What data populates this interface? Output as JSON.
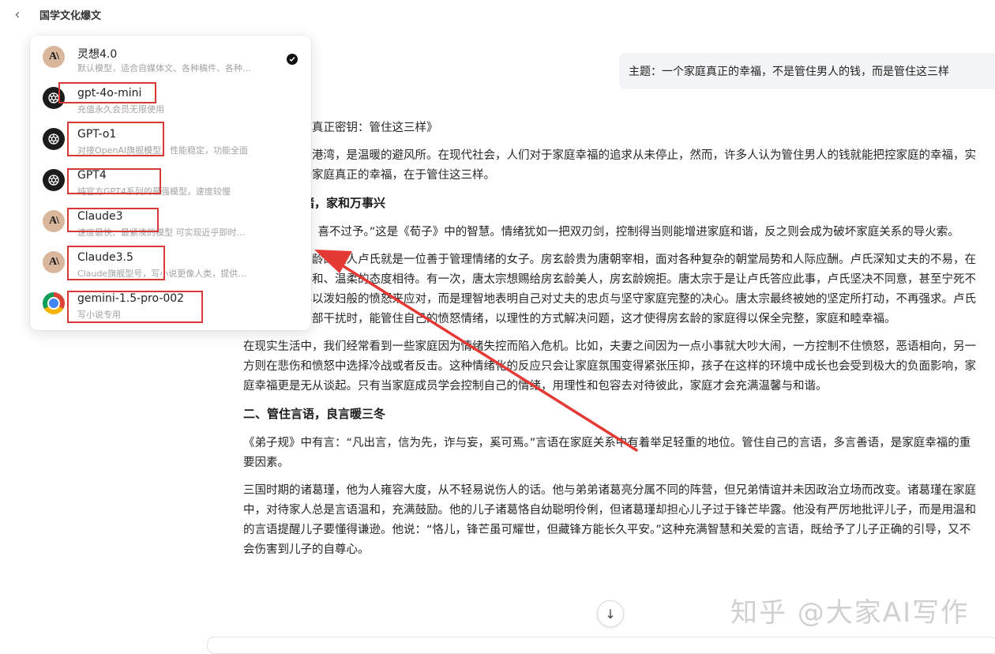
{
  "header": {
    "title": "国学文化爆文"
  },
  "user_message": "主题：一个家庭真正的幸福，不是管住男人的钱，而是管住这三样",
  "models": [
    {
      "name": "灵想4.0",
      "desc": "默认模型，适合自媒体文、各种稿件、各种…",
      "icon": "claude-icon",
      "selected": true
    },
    {
      "name": "gpt-4o-mini",
      "desc": "充值永久会员无限使用",
      "icon": "openai-icon"
    },
    {
      "name": "GPT-o1",
      "desc": "对接OpenAI旗舰模型，性能稳定，功能全面",
      "icon": "openai-icon"
    },
    {
      "name": "GPT4",
      "desc": "纯官方GPT4系列的最强模型，速度较慢",
      "icon": "openai-icon"
    },
    {
      "name": "Claude3",
      "desc": "速度最快、最紧凑的模型 可实现近乎即时…",
      "icon": "claude-icon"
    },
    {
      "name": "Claude3.5",
      "desc": "Claude旗舰型号，写小说更像人类，提供…",
      "icon": "claude-icon"
    },
    {
      "name": "gemini-1.5-pro-002",
      "desc": "写小说专用",
      "icon": "gemini-icon"
    }
  ],
  "article": {
    "title_line": "《家庭幸福的真正密钥：管住这三样》",
    "intro": "家庭是心灵的港湾，是温暖的避风所。在现代社会，人们对于家庭幸福的追求从未停止，然而，许多人认为管住男人的钱就能把控家庭的幸福，实则不然。一个家庭真正的幸福，在于管住这三样。",
    "h1": "一、管住情绪，家和万事兴",
    "p1": "“喜怒不过夺，喜不过予。”这是《荀子》中的智慧。情绪犹如一把双刃剑，控制得当则能增进家庭和谐，反之则会成为破坏家庭关系的导火索。",
    "p2": "唐朝名相房玄龄的夫人卢氏就是一位善于管理情绪的女子。房玄龄贵为唐朝宰相，面对各种复杂的朝堂局势和人际应酬。卢氏深知丈夫的不易，在家中总是以平和、温柔的态度相待。有一次，唐太宗想赐给房玄龄美人，房玄龄婉拒。唐太宗于是让卢氏答应此事，卢氏坚决不同意，甚至宁死不屈。但她并非以泼妇般的愤怒来应对，而是理智地表明自己对丈夫的忠贞与坚守家庭完整的决心。唐太宗最终被她的坚定所打动，不再强求。卢氏在家庭面临外部干扰时，能管住自己的愤怒情绪，以理性的方式解决问题，这才使得房玄龄的家庭得以保全完整，家庭和睦幸福。",
    "p3": "在现实生活中，我们经常看到一些家庭因为情绪失控而陷入危机。比如，夫妻之间因为一点小事就大吵大闹，一方控制不住愤怒，恶语相向，另一方则在悲伤和愤怒中选择冷战或者反击。这种情绪化的反应只会让家庭氛围变得紧张压抑，孩子在这样的环境中成长也会受到极大的负面影响，家庭幸福更是无从谈起。只有当家庭成员学会控制自己的情绪，用理性和包容去对待彼此，家庭才会充满温馨与和谐。",
    "h2": "二、管住言语，良言暖三冬",
    "p4": "《弟子规》中有言：“凡出言，信为先，诈与妄，奚可焉。”言语在家庭关系中有着举足轻重的地位。管住自己的言语，多言善语，是家庭幸福的重要因素。",
    "p5": "三国时期的诸葛瑾，他为人雍容大度，从不轻易说伤人的话。他与弟弟诸葛亮分属不同的阵营，但兄弟情谊并未因政治立场而改变。诸葛瑾在家庭中，对待家人总是言语温和，充满鼓励。他的儿子诸葛恪自幼聪明伶俐，但诸葛瑾却担心儿子过于锋芒毕露。他没有严厉地批评儿子，而是用温和的言语提醒儿子要懂得谦逊。他说：“恪儿，锋芒虽可耀世，但藏锋方能长久平安。”这种充满智慧和关爱的言语，既给予了儿子正确的引导，又不会伤害到儿子的自尊心。"
  },
  "watermark": "知乎 @大家AI写作",
  "colors": {
    "highlight": "#d93838",
    "bubble": "#f3f4f6"
  }
}
